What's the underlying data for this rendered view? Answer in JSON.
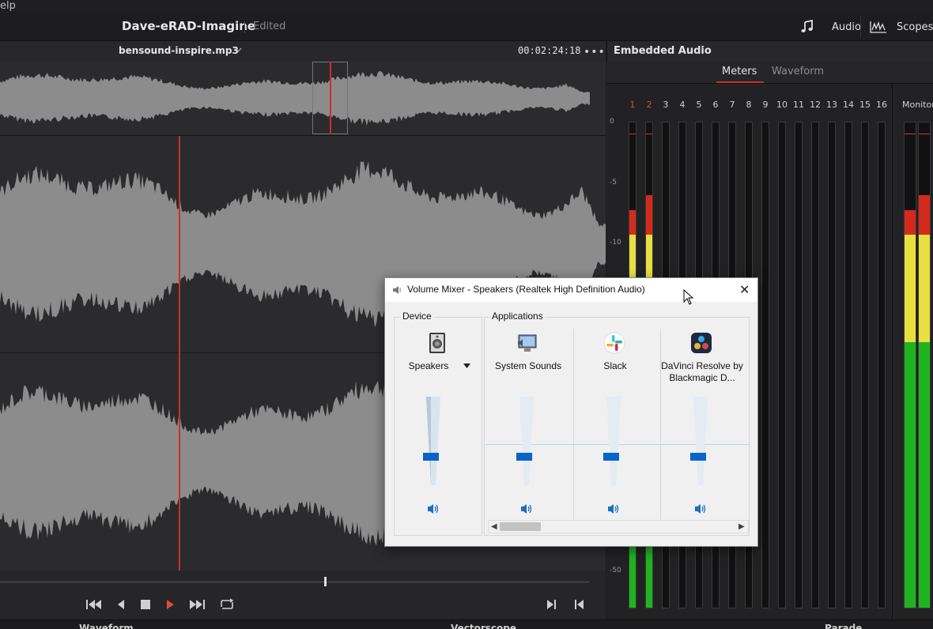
{
  "menu": {
    "help_partial": "elp"
  },
  "header": {
    "project_title": "Dave-eRAD-Imagine",
    "project_status": "Edited",
    "audio_label": "Audio",
    "scopes_label": "Scopes"
  },
  "clip": {
    "name": "bensound-inspire.mp3",
    "timecode": "00:02:24:18"
  },
  "embedded_audio": {
    "title": "Embedded Audio",
    "tabs": [
      {
        "label": "Meters",
        "active": true
      },
      {
        "label": "Waveform",
        "active": false
      }
    ],
    "channels": [
      "1",
      "2",
      "3",
      "4",
      "5",
      "6",
      "7",
      "8",
      "9",
      "10",
      "11",
      "12",
      "13",
      "14",
      "15",
      "16"
    ],
    "db_scale": [
      "0",
      "-5",
      "-10",
      "-50"
    ],
    "monitor_label": "Monitor",
    "levels": {
      "ch1": 0.82,
      "ch2": 0.85
    }
  },
  "bottom": {
    "waveform_label": "Waveform",
    "vectorscope_label": "Vectorscope",
    "parade_label": "Parade"
  },
  "volume_mixer": {
    "title": "Volume Mixer - Speakers (Realtek High Definition Audio)",
    "device_group_label": "Device",
    "applications_group_label": "Applications",
    "device": {
      "name": "Speakers",
      "level": 0.3
    },
    "apps": [
      {
        "name": "System Sounds",
        "icon": "system-sounds-icon",
        "level": 0.3
      },
      {
        "name": "Slack",
        "icon": "slack-icon",
        "level": 0.3
      },
      {
        "name": "DaVinci Resolve by Blackmagic D...",
        "icon": "davinci-resolve-icon",
        "level": 0.3
      }
    ]
  },
  "colors": {
    "accent_red": "#c9302c",
    "meter_green": "#1fb41f",
    "meter_yellow": "#e8e040",
    "meter_red": "#d42a1c",
    "windows_blue": "#0a64c8"
  }
}
